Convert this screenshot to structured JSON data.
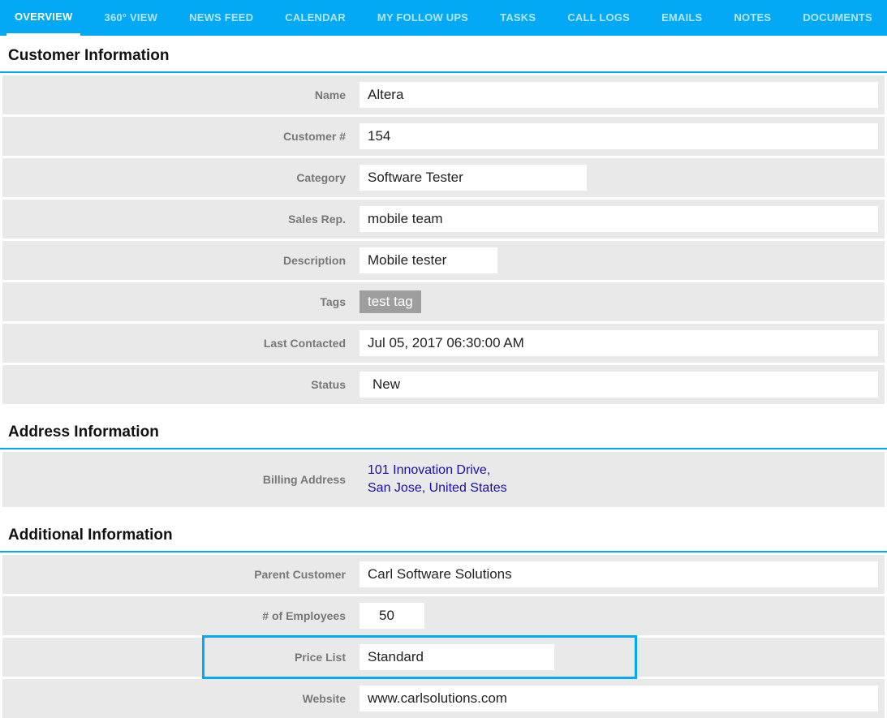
{
  "tabs": [
    {
      "label": "OVERVIEW",
      "active": true
    },
    {
      "label": "360° VIEW",
      "active": false
    },
    {
      "label": "NEWS FEED",
      "active": false
    },
    {
      "label": "CALENDAR",
      "active": false
    },
    {
      "label": "MY FOLLOW UPS",
      "active": false
    },
    {
      "label": "TASKS",
      "active": false
    },
    {
      "label": "CALL LOGS",
      "active": false
    },
    {
      "label": "EMAILS",
      "active": false
    },
    {
      "label": "NOTES",
      "active": false
    },
    {
      "label": "DOCUMENTS",
      "active": false
    }
  ],
  "sections": {
    "customer": {
      "title": "Customer Information",
      "fields": {
        "name": {
          "label": "Name",
          "value": "Altera"
        },
        "number": {
          "label": "Customer #",
          "value": "154"
        },
        "category": {
          "label": "Category",
          "value": "Software Tester"
        },
        "salesrep": {
          "label": "Sales Rep.",
          "value": "mobile team"
        },
        "description": {
          "label": "Description",
          "value": "Mobile tester"
        },
        "tags": {
          "label": "Tags",
          "value": "test tag"
        },
        "lastcontacted": {
          "label": "Last Contacted",
          "value": "Jul 05, 2017 06:30:00 AM"
        },
        "status": {
          "label": "Status",
          "value": "New"
        }
      }
    },
    "address": {
      "title": "Address Information",
      "fields": {
        "billing": {
          "label": "Billing Address",
          "line1": "101 Innovation Drive,",
          "line2": "San Jose, United States"
        }
      }
    },
    "additional": {
      "title": "Additional Information",
      "fields": {
        "parent": {
          "label": "Parent Customer",
          "value": "Carl Software Solutions"
        },
        "employees": {
          "label": "# of Employees",
          "value": "50"
        },
        "pricelist": {
          "label": "Price List",
          "value": "Standard"
        },
        "website": {
          "label": "Website",
          "value": "www.carlsolutions.com"
        }
      }
    }
  }
}
